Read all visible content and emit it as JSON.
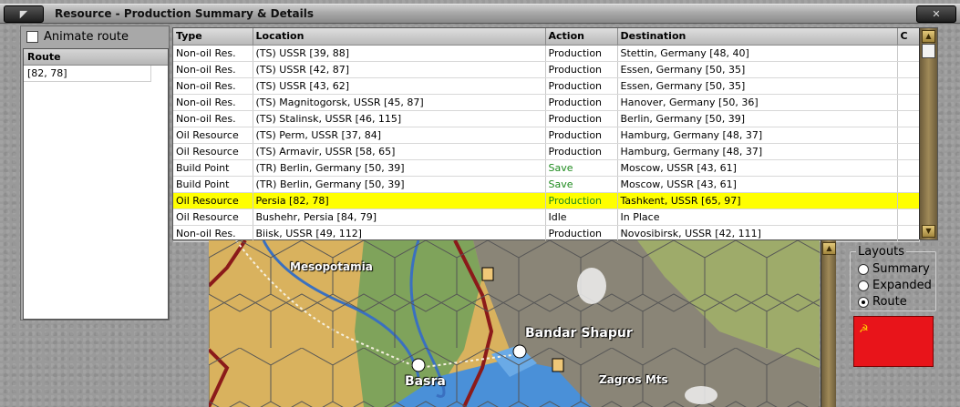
{
  "window": {
    "title": "Resource - Production Summary & Details",
    "close_symbol": "✕"
  },
  "left_panel": {
    "animate_label": "Animate route",
    "route_header": "Route",
    "route_values": [
      "[82, 78]"
    ]
  },
  "table": {
    "columns": [
      "Type",
      "Location",
      "Action",
      "Destination",
      "C"
    ],
    "rows": [
      {
        "type": "Non-oil Res.",
        "location": "(TS) USSR [39, 88]",
        "action": "Production",
        "destination": "Stettin, Germany [48, 40]"
      },
      {
        "type": "Non-oil Res.",
        "location": "(TS) USSR [42, 87]",
        "action": "Production",
        "destination": "Essen, Germany [50, 35]"
      },
      {
        "type": "Non-oil Res.",
        "location": "(TS) USSR [43, 62]",
        "action": "Production",
        "destination": "Essen, Germany [50, 35]"
      },
      {
        "type": "Non-oil Res.",
        "location": "(TS) Magnitogorsk, USSR [45, 87]",
        "action": "Production",
        "destination": "Hanover, Germany [50, 36]"
      },
      {
        "type": "Non-oil Res.",
        "location": "(TS) Stalinsk, USSR [46, 115]",
        "action": "Production",
        "destination": "Berlin, Germany [50, 39]"
      },
      {
        "type": "Oil Resource",
        "location": "(TS) Perm, USSR [37, 84]",
        "action": "Production",
        "destination": "Hamburg, Germany [48, 37]"
      },
      {
        "type": "Oil Resource",
        "location": "(TS) Armavir, USSR [58, 65]",
        "action": "Production",
        "destination": "Hamburg, Germany [48, 37]"
      },
      {
        "type": "Build Point",
        "location": "(TR) Berlin, Germany [50, 39]",
        "action": "Save",
        "destination": "Moscow, USSR [43, 61]"
      },
      {
        "type": "Build Point",
        "location": "(TR) Berlin, Germany [50, 39]",
        "action": "Save",
        "destination": "Moscow, USSR [43, 61]"
      },
      {
        "type": "Oil Resource",
        "location": "Persia [82, 78]",
        "action": "Production",
        "destination": "Tashkent, USSR [65, 97]"
      },
      {
        "type": "Oil Resource",
        "location": "Bushehr, Persia [84, 79]",
        "action": "Idle",
        "destination": "In Place"
      },
      {
        "type": "Non-oil Res.",
        "location": "Biisk, USSR [49, 112]",
        "action": "Production",
        "destination": "Novosibirsk, USSR [42, 111]"
      }
    ],
    "selected_row": 9
  },
  "map": {
    "labels": [
      "Mesopotamia",
      "Bandar Shapur",
      "Basra",
      "Zagros Mts"
    ]
  },
  "layouts": {
    "legend": "Layouts",
    "options": [
      "Summary",
      "Expanded",
      "Route"
    ],
    "selected": "Route"
  },
  "flag": {
    "emblem": "☭",
    "color": "#e8141a"
  },
  "colors": {
    "selection": "#ffff00",
    "save_action": "#1d8a1d"
  }
}
